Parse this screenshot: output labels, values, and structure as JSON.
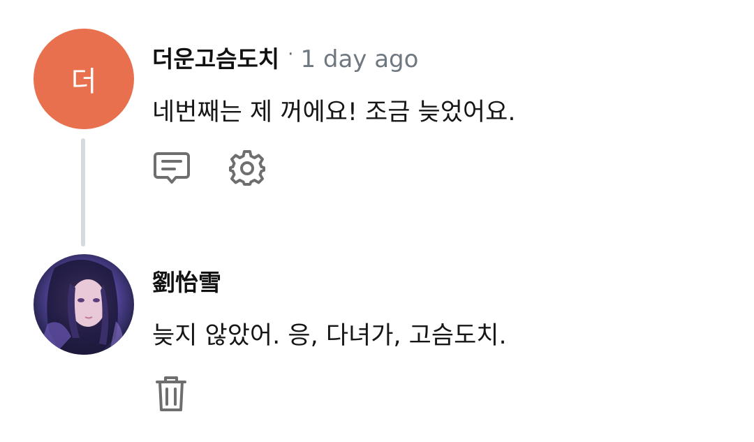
{
  "comments": [
    {
      "avatar_letter": "더",
      "avatar_color": "#e8704f",
      "username": "더운고슴도치",
      "separator": "·",
      "timestamp": "1 day ago",
      "text": "네번째는 제 꺼에요! 조금 늦었어요.",
      "actions": [
        "reply-icon",
        "gear-icon"
      ]
    },
    {
      "avatar_type": "photo",
      "username": "劉怡雪",
      "text": "늦지 않았어. 응, 다녀가, 고슴도치.",
      "actions": [
        "trash-icon"
      ]
    }
  ],
  "colors": {
    "thread_line": "#d6dadd",
    "icon": "#6e6e6e",
    "timestamp": "#6f7880"
  }
}
